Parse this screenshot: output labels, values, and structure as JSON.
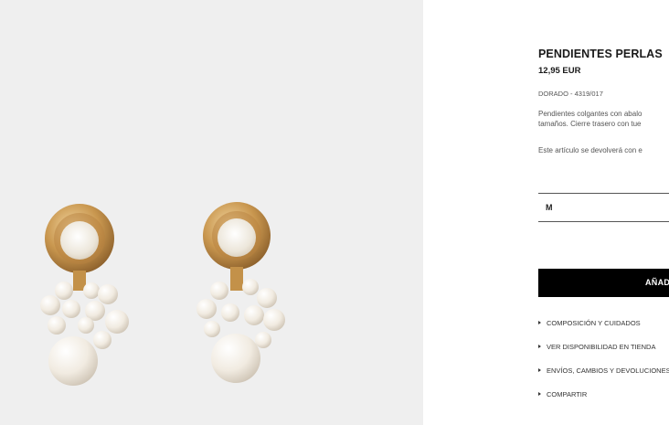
{
  "product": {
    "title": "PENDIENTES PERLAS",
    "price": "12,95 EUR",
    "color_ref": "DORADO - 4319/017",
    "description_line1": "Pendientes colgantes con abalo",
    "description_line2": "tamaños. Cierre trasero con tue",
    "returns_note": "Este artículo se devolverá con e"
  },
  "size_selector": {
    "value": "M"
  },
  "add_button": {
    "label": "AÑAD"
  },
  "links": [
    {
      "label": "COMPOSICIÓN Y CUIDADOS"
    },
    {
      "label": "VER DISPONIBILIDAD EN TIENDA"
    },
    {
      "label": "ENVÍOS, CAMBIOS Y DEVOLUCIONES"
    },
    {
      "label": "COMPARTIR"
    }
  ],
  "image": {
    "alt_subject": "earrings-photo"
  },
  "colors": {
    "accent": "#000000",
    "photo_bg": "#efefef",
    "gold": "#c9974f",
    "pearl": "#f4efe6"
  },
  "icons": [
    "arrow-right-icon"
  ]
}
